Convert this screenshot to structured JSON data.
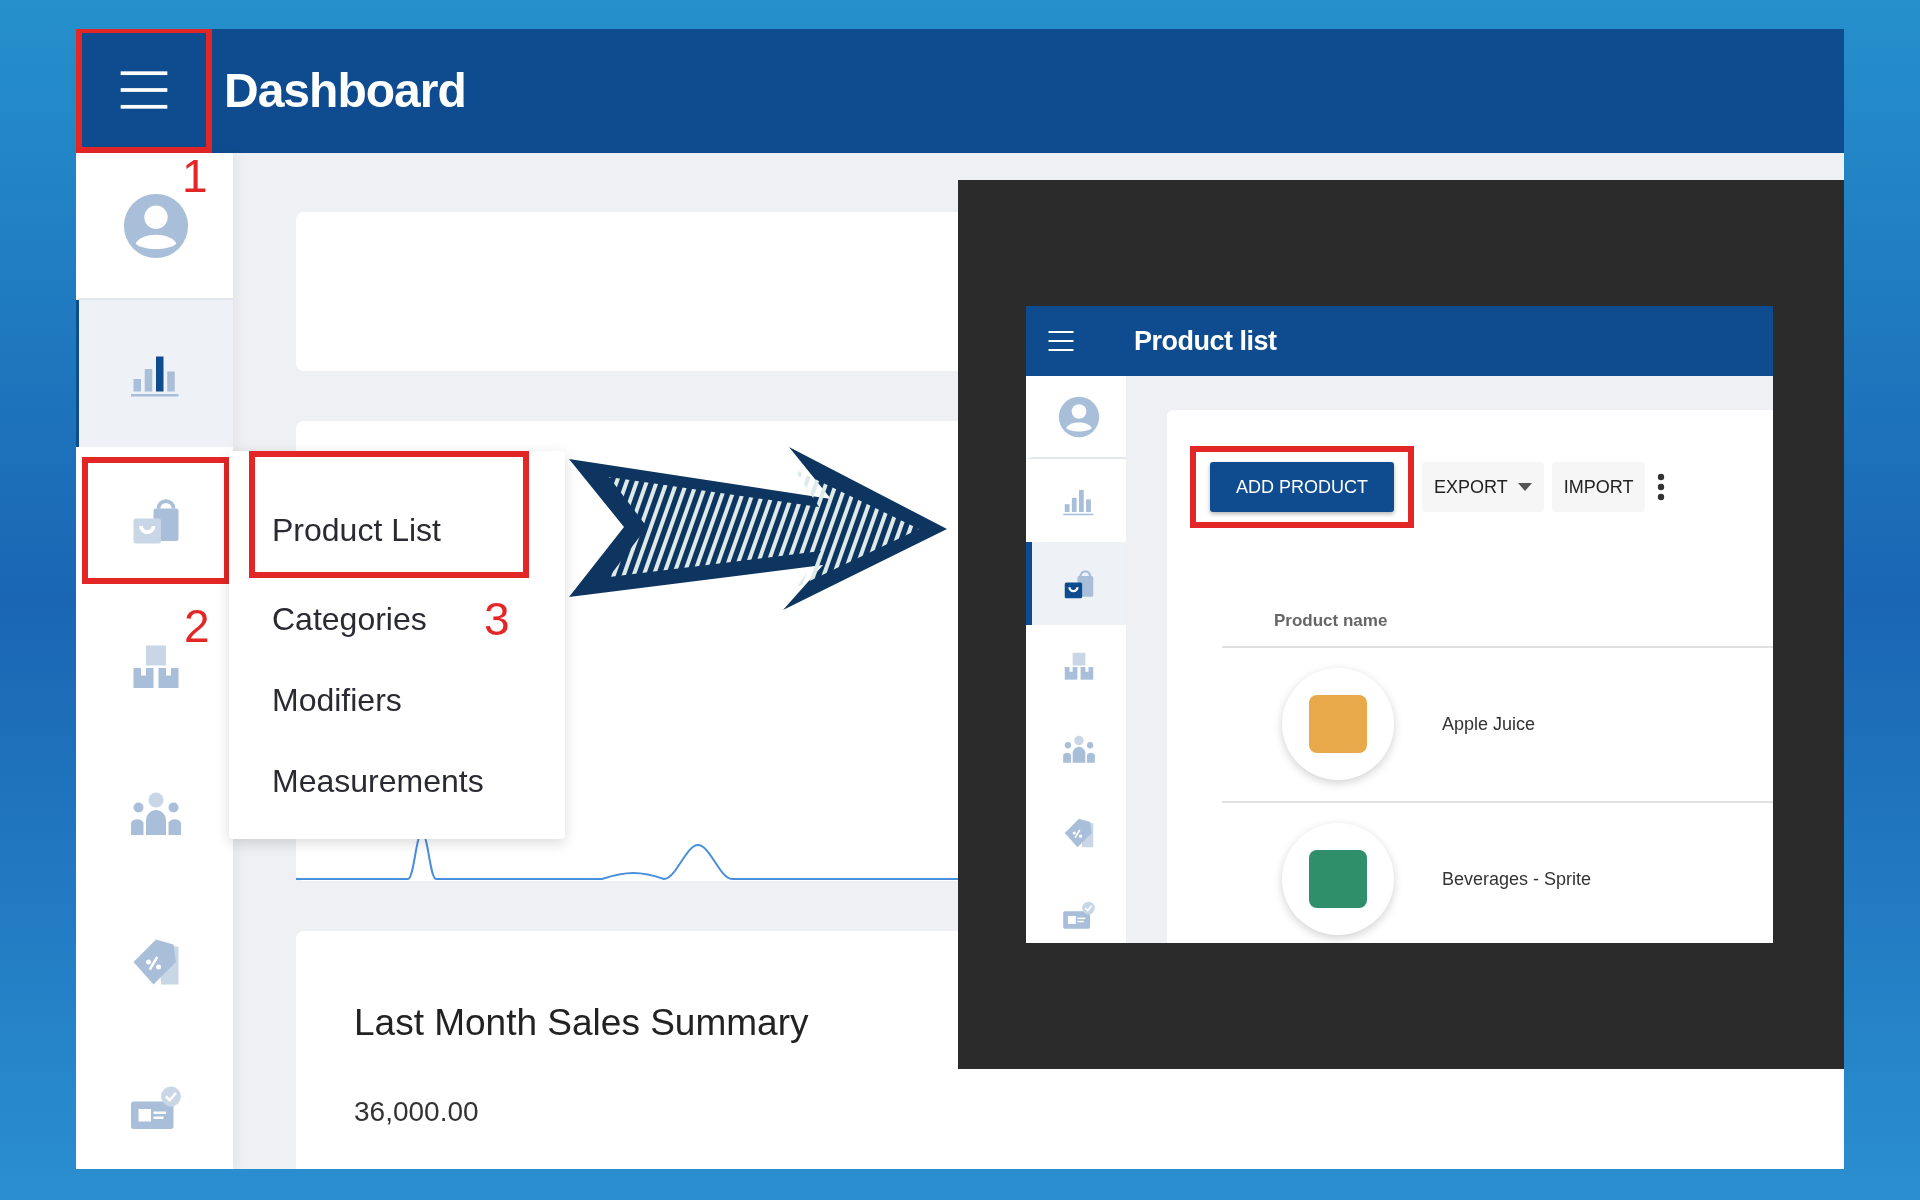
{
  "header": {
    "title": "Dashboard",
    "highlighted": true,
    "callout": "1"
  },
  "sidebar": {
    "items": [
      {
        "kind": "profile",
        "selected": false
      },
      {
        "kind": "chart",
        "selected": true
      },
      {
        "kind": "bag",
        "selected": false,
        "callout": "2"
      },
      {
        "kind": "boxes",
        "selected": false
      },
      {
        "kind": "people",
        "selected": false
      },
      {
        "kind": "tag",
        "selected": false
      },
      {
        "kind": "card",
        "selected": false
      }
    ]
  },
  "dropdown_menu": {
    "items": [
      {
        "label": "Product List",
        "highlighted": true,
        "callout": "3"
      },
      {
        "label": "Categories",
        "highlighted": false
      },
      {
        "label": "Modifiers",
        "highlighted": false
      },
      {
        "label": "Measurements",
        "highlighted": false
      }
    ]
  },
  "summary_card": {
    "title": "Last Month Sales Summary",
    "value": "36,000.00"
  },
  "inset": {
    "title": "Product list",
    "sidebar": {
      "items": [
        {
          "kind": "profile",
          "selected": false
        },
        {
          "kind": "chart",
          "selected": false
        },
        {
          "kind": "bag",
          "selected": true
        },
        {
          "kind": "boxes",
          "selected": false
        },
        {
          "kind": "people",
          "selected": false
        },
        {
          "kind": "tag",
          "selected": false
        },
        {
          "kind": "card",
          "selected": false
        }
      ]
    },
    "toolbar": [
      {
        "kind": "primary",
        "label": "ADD PRODUCT",
        "highlighted": true
      },
      {
        "kind": "dropdown",
        "label": "EXPORT",
        "highlighted": false
      },
      {
        "kind": "plain",
        "label": "IMPORT",
        "highlighted": false
      },
      {
        "kind": "more",
        "highlighted": false
      }
    ],
    "table": {
      "columns": [
        "Product name"
      ],
      "rows": [
        {
          "name": "Apple Juice"
        },
        {
          "name": "Beverages - Sprite"
        }
      ]
    }
  }
}
